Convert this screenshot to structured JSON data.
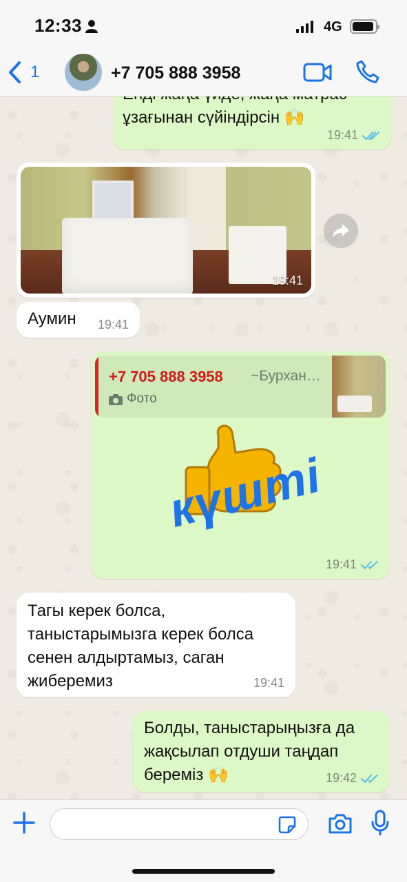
{
  "status_bar": {
    "time": "12:33",
    "network": "4G"
  },
  "header": {
    "back_count": "1",
    "contact_name": "+7 705 888 3958"
  },
  "messages": [
    {
      "id": "m1",
      "direction": "outgoing",
      "text_partial_top": "Енді жаңа үйде, жаңа матрас",
      "text": "ұзағынан сүйіндірсін 🙌",
      "time": "19:41",
      "read": true
    },
    {
      "id": "m2",
      "direction": "incoming",
      "type": "photo",
      "time": "19:41"
    },
    {
      "id": "m3",
      "direction": "incoming",
      "text": "Аумин",
      "time": "19:41"
    },
    {
      "id": "m4",
      "direction": "outgoing",
      "type": "sticker-reply",
      "quote": {
        "name": "+7 705 888 3958",
        "author": "~Бурхан…",
        "type_label": "Фото"
      },
      "sticker_text": "күшті",
      "time": "19:41",
      "read": true
    },
    {
      "id": "m5",
      "direction": "incoming",
      "lines": [
        "Тагы керек болса,",
        "таныстарымызга керек болса",
        "сенен алдыртамыз, саган",
        "жиберемиз"
      ],
      "time": "19:41"
    },
    {
      "id": "m6",
      "direction": "outgoing",
      "lines": [
        "Болды, таныстарыңызға да",
        "жақсылап отдуши таңдап",
        "береміз 🙌"
      ],
      "time": "19:42",
      "read": true
    }
  ],
  "colors": {
    "accent": "#1a73e8",
    "outgoing_bubble": "#dcf8c6",
    "incoming_bubble": "#ffffff",
    "quote_name": "#d11a1a",
    "read_ticks": "#53bdeb"
  },
  "icons": [
    "back-chevron-icon",
    "video-call-icon",
    "phone-icon",
    "forward-icon",
    "camera-icon",
    "plus-icon",
    "sticker-icon",
    "mic-icon",
    "double-check-icon"
  ]
}
